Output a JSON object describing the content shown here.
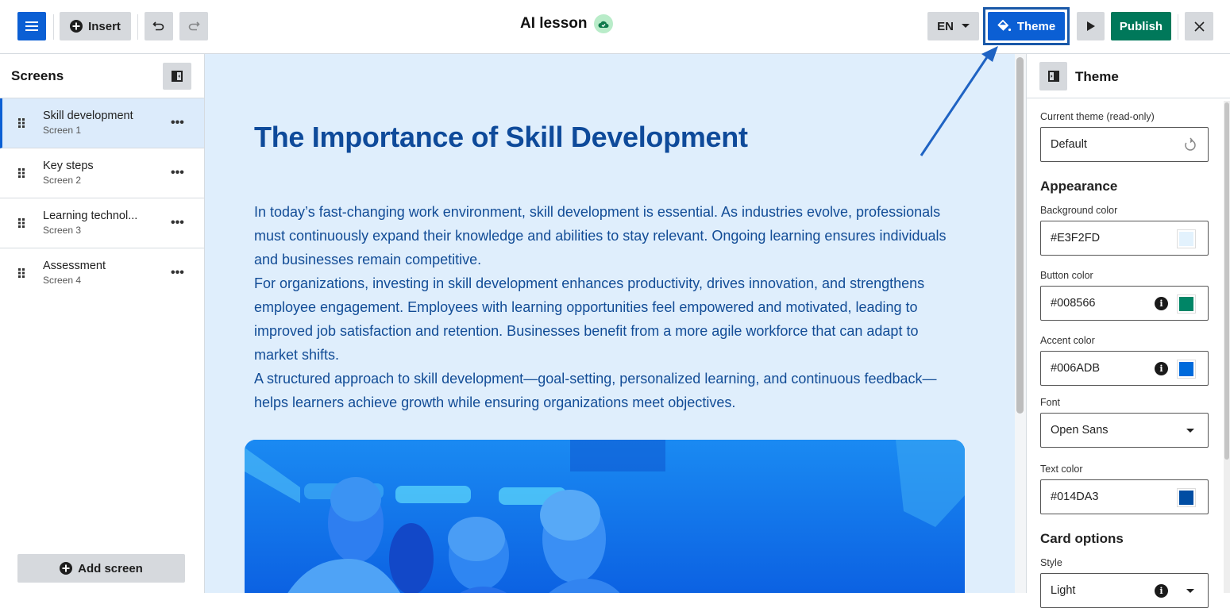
{
  "header": {
    "insert_label": "Insert",
    "title": "AI lesson",
    "language": "EN",
    "theme_label": "Theme",
    "publish_label": "Publish"
  },
  "sidebar": {
    "title": "Screens",
    "items": [
      {
        "name": "Skill development",
        "sub": "Screen 1",
        "active": true
      },
      {
        "name": "Key steps",
        "sub": "Screen 2",
        "active": false
      },
      {
        "name": "Learning technol...",
        "sub": "Screen 3",
        "active": false
      },
      {
        "name": "Assessment",
        "sub": "Screen 4",
        "active": false
      }
    ],
    "more_label": "•••",
    "add_screen_label": "Add screen"
  },
  "canvas": {
    "heading": "The Importance of Skill Development",
    "paragraphs": [
      "In today’s fast-changing work environment, skill development is essential. As industries evolve, professionals must continuously expand their knowledge and abilities to stay relevant. Ongoing learning ensures individuals and businesses remain competitive.",
      "For organizations, investing in skill development enhances productivity, drives innovation, and strengthens employee engagement. Employees with learning opportunities feel empowered and motivated, leading to improved job satisfaction and retention. Businesses benefit from a more agile workforce that can adapt to market shifts.",
      "A structured approach to skill development—goal-setting, personalized learning, and continuous feedback—helps learners achieve growth while ensuring organizations meet objectives."
    ],
    "image_alt": "Team of people collaborating (blue-tinted photo)"
  },
  "theme_panel": {
    "title": "Theme",
    "current_theme_label": "Current theme (read-only)",
    "current_theme_value": "Default",
    "appearance_heading": "Appearance",
    "background_color_label": "Background color",
    "background_color": "#E3F2FD",
    "button_color_label": "Button color",
    "button_color": "#008566",
    "accent_color_label": "Accent color",
    "accent_color": "#006ADB",
    "font_label": "Font",
    "font_value": "Open Sans",
    "text_color_label": "Text color",
    "text_color": "#014DA3",
    "card_options_heading": "Card options",
    "style_label": "Style",
    "style_value": "Light",
    "info_glyph": "i"
  }
}
